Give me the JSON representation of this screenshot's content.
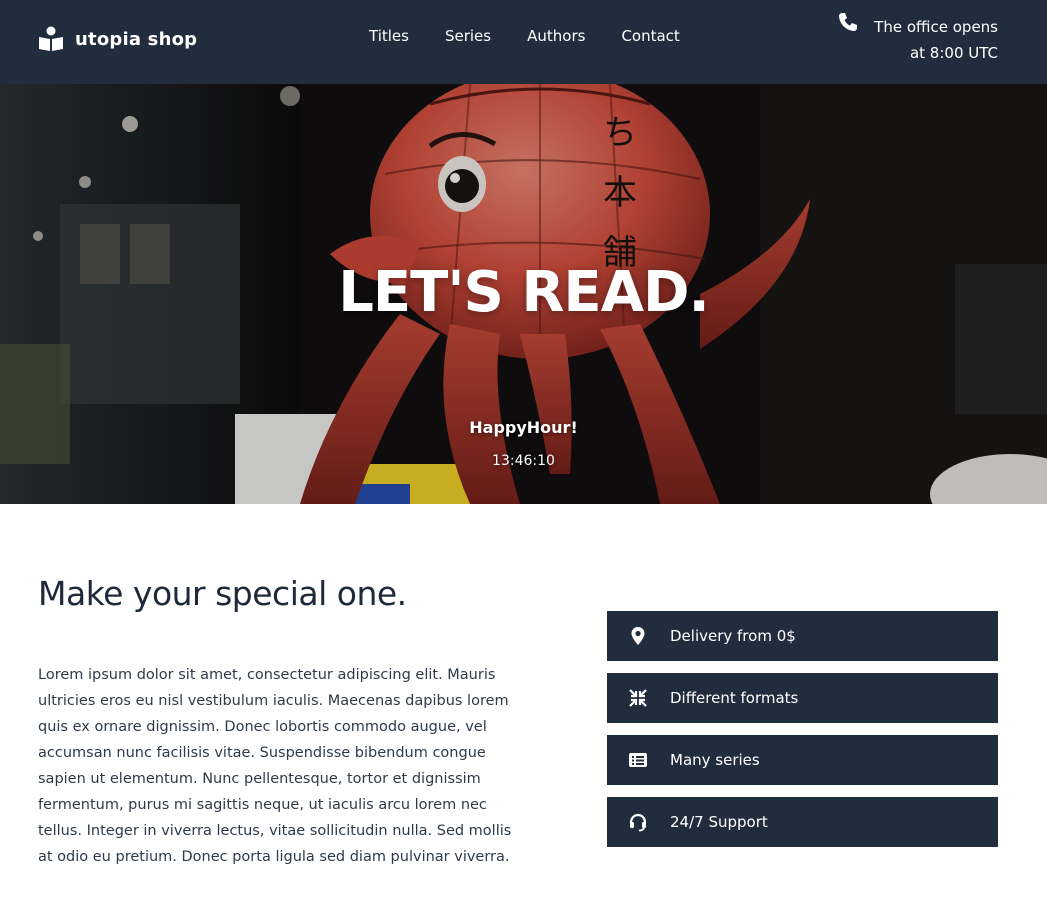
{
  "header": {
    "logo_icon": "book-reader-icon",
    "brand": "utopia shop",
    "nav": [
      {
        "label": "Titles"
      },
      {
        "label": "Series"
      },
      {
        "label": "Authors"
      },
      {
        "label": "Contact"
      }
    ],
    "phone_icon": "phone-icon",
    "office_line1": "The office opens",
    "office_line2": "at 8:00 UTC"
  },
  "hero": {
    "title": "LET'S READ.",
    "subtitle": "HappyHour!",
    "countdown": "13:46:10"
  },
  "content": {
    "title": "Make your special one.",
    "body": "Lorem ipsum dolor sit amet, consectetur adipiscing elit. Mauris ultricies eros eu nisl vestibulum iaculis. Maecenas dapibus lorem quis ex ornare dignissim. Donec lobortis commodo augue, vel accumsan nunc facilisis vitae. Suspendisse bibendum congue sapien ut elementum. Nunc pellentesque, tortor et dignissim fermentum, purus mi sagittis neque, ut iaculis arcu lorem nec tellus. Integer in viverra lectus, vitae sollicitudin nulla. Sed mollis at odio eu pretium. Donec porta ligula sed diam pulvinar viverra."
  },
  "features": [
    {
      "icon": "map-marker-icon",
      "label": "Delivery from 0$"
    },
    {
      "icon": "compress-icon",
      "label": "Different formats"
    },
    {
      "icon": "list-icon",
      "label": "Many series"
    },
    {
      "icon": "headset-icon",
      "label": "24/7 Support"
    }
  ],
  "colors": {
    "header_bg": "#212d3d",
    "feature_bg": "#212d3d",
    "text_dark": "#1e2a3a"
  }
}
